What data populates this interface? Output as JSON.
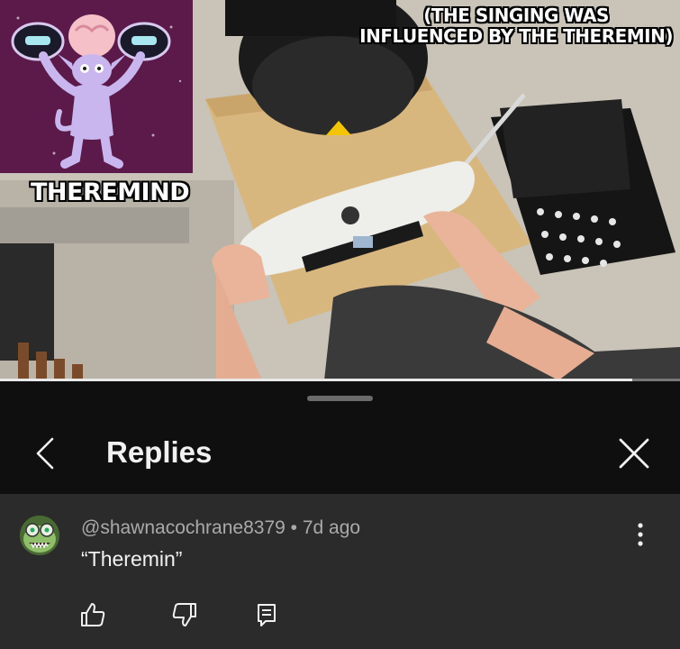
{
  "video": {
    "caption_lines": [
      "(THE SINGING WAS",
      "INFLUENCED BY THE THEREMIN)"
    ],
    "monster_name": "THEREMIND",
    "progress": 0.93
  },
  "panel": {
    "title": "Replies",
    "back_icon": "chevron-left-icon",
    "close_icon": "close-icon"
  },
  "comment": {
    "author": "@shawnacochrane8379",
    "separator": "•",
    "age": "7d ago",
    "text": "“Theremin”",
    "actions": [
      "like-icon",
      "dislike-icon",
      "reply-icon"
    ]
  }
}
